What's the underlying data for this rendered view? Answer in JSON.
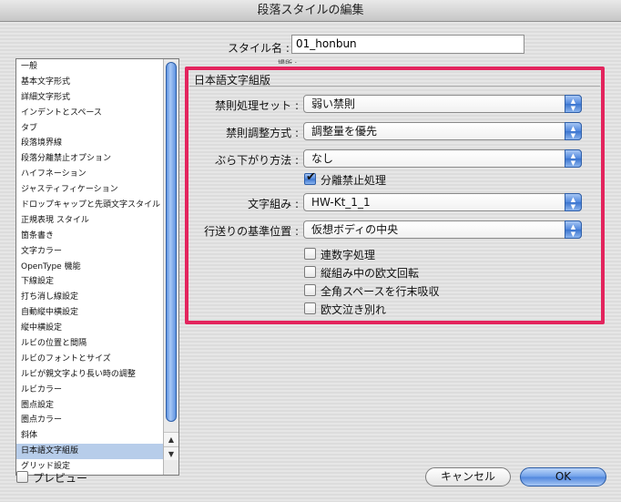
{
  "window": {
    "title": "段落スタイルの編集"
  },
  "sidebar": {
    "items": [
      "一般",
      "基本文字形式",
      "詳細文字形式",
      "インデントとスペース",
      "タブ",
      "段落境界線",
      "段落分離禁止オプション",
      "ハイフネーション",
      "ジャスティフィケーション",
      "ドロップキャップと先頭文字スタイル",
      "正規表現 スタイル",
      "箇条書き",
      "文字カラー",
      "OpenType 機能",
      "下線設定",
      "打ち消し線設定",
      "自動縦中横設定",
      "縦中横設定",
      "ルビの位置と間隔",
      "ルビのフォントとサイズ",
      "ルビが親文字より長い時の調整",
      "ルビカラー",
      "圏点設定",
      "圏点カラー",
      "斜体",
      "日本語文字組版",
      "グリッド設定"
    ],
    "selected_index": 25
  },
  "style_name": {
    "label": "スタイル名 :",
    "value": "01_honbun"
  },
  "location_label": "場所 :",
  "section": {
    "title": "日本語文字組版",
    "kinsoku_set": {
      "label": "禁則処理セット :",
      "value": "弱い禁則"
    },
    "kinsoku_adjust": {
      "label": "禁則調整方式 :",
      "value": "調整量を優先"
    },
    "burasagari": {
      "label": "ぶら下がり方法 :",
      "value": "なし"
    },
    "bunri_kinshi": {
      "label": "分離禁止処理",
      "checked": true
    },
    "mojikumi": {
      "label": "文字組み :",
      "value": "HW-Kt_1_1"
    },
    "baseline": {
      "label": "行送りの基準位置 :",
      "value": "仮想ボディの中央"
    },
    "checkboxes": [
      {
        "label": "連数字処理",
        "checked": false
      },
      {
        "label": "縦組み中の欧文回転",
        "checked": false
      },
      {
        "label": "全角スペースを行末吸収",
        "checked": false
      },
      {
        "label": "欧文泣き別れ",
        "checked": false
      }
    ]
  },
  "preview": {
    "label": "プレビュー",
    "checked": false
  },
  "buttons": {
    "cancel": "キャンセル",
    "ok": "OK"
  },
  "colors": {
    "highlight_frame": "#e3245d",
    "selected_item": "#b7cdea",
    "aqua_blue": "#4f86dd"
  },
  "glyphs": {
    "arrow_up": "▲",
    "arrow_down": "▼",
    "check": "✔"
  }
}
